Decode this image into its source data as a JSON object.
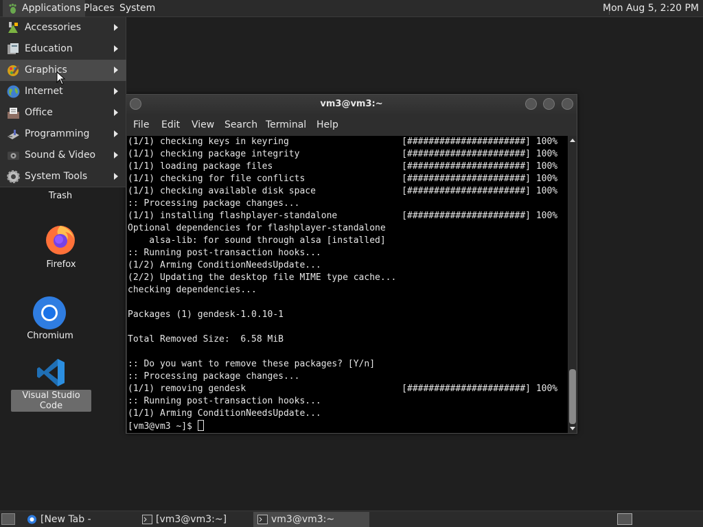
{
  "top_panel": {
    "menus": [
      "Applications",
      "Places",
      "System"
    ],
    "clock": "Mon Aug  5,  2:20 PM"
  },
  "app_menu": {
    "items": [
      {
        "label": "Accessories",
        "icon": "accessories-icon"
      },
      {
        "label": "Education",
        "icon": "education-icon"
      },
      {
        "label": "Graphics",
        "icon": "graphics-icon"
      },
      {
        "label": "Internet",
        "icon": "internet-icon"
      },
      {
        "label": "Office",
        "icon": "office-icon"
      },
      {
        "label": "Programming",
        "icon": "programming-icon"
      },
      {
        "label": "Sound & Video",
        "icon": "sound-video-icon"
      },
      {
        "label": "System Tools",
        "icon": "system-tools-icon"
      }
    ],
    "hovered": "Graphics"
  },
  "desktop": {
    "icons": [
      {
        "label": "Trash"
      },
      {
        "label": "Firefox"
      },
      {
        "label": "Chromium"
      },
      {
        "label": "Visual Studio Code"
      }
    ]
  },
  "terminal": {
    "title": "vm3@vm3:~",
    "menu": [
      "File",
      "Edit",
      "View",
      "Search",
      "Terminal",
      "Help"
    ],
    "lines": [
      "(1/1) checking keys in keyring                     [######################] 100%",
      "(1/1) checking package integrity                   [######################] 100%",
      "(1/1) loading package files                        [######################] 100%",
      "(1/1) checking for file conflicts                  [######################] 100%",
      "(1/1) checking available disk space                [######################] 100%",
      ":: Processing package changes...",
      "(1/1) installing flashplayer-standalone            [######################] 100%",
      "Optional dependencies for flashplayer-standalone",
      "    alsa-lib: for sound through alsa [installed]",
      ":: Running post-transaction hooks...",
      "(1/2) Arming ConditionNeedsUpdate...",
      "(2/2) Updating the desktop file MIME type cache...",
      "checking dependencies...",
      "",
      "Packages (1) gendesk-1.0.10-1",
      "",
      "Total Removed Size:  6.58 MiB",
      "",
      ":: Do you want to remove these packages? [Y/n]",
      ":: Processing package changes...",
      "(1/1) removing gendesk                             [######################] 100%",
      ":: Running post-transaction hooks...",
      "(1/1) Arming ConditionNeedsUpdate..."
    ],
    "prompt": "[vm3@vm3 ~]$ "
  },
  "taskbar": {
    "tasks": [
      {
        "label": "[New Tab - Chromi...",
        "icon": "chromium-icon"
      },
      {
        "label": "[vm3@vm3:~]",
        "icon": "terminal-icon"
      },
      {
        "label": "vm3@vm3:~",
        "icon": "terminal-icon"
      }
    ],
    "active_task": "vm3@vm3:~"
  }
}
